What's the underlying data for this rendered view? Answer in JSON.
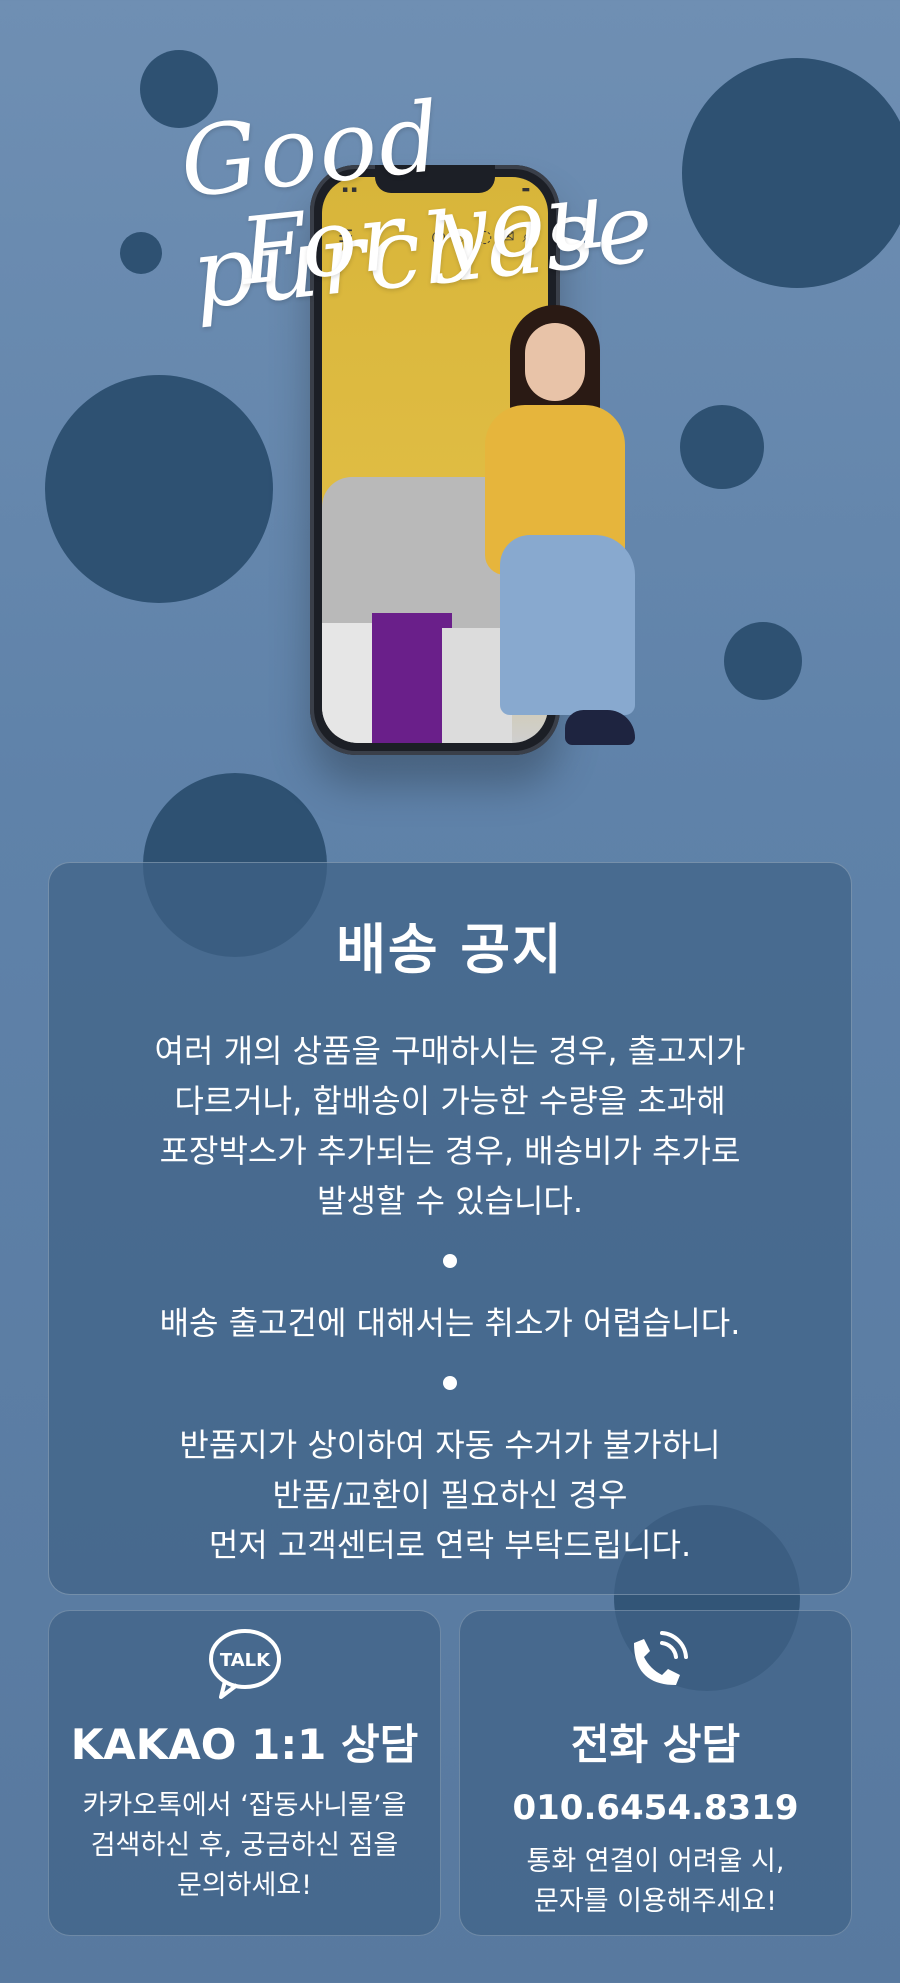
{
  "hero": {
    "script_line1": "Good purchase",
    "script_line2": "For you"
  },
  "notice": {
    "title": "배송 공지",
    "paragraph1_lines": [
      "여러 개의 상품을 구매하시는 경우, 출고지가",
      "다르거나, 합배송이 가능한 수량을 초과해",
      "포장박스가 추가되는 경우, 배송비가 추가로",
      "발생할 수 있습니다."
    ],
    "paragraph2": "배송 출고건에 대해서는 취소가 어렵습니다.",
    "paragraph3_lines": [
      "반품지가 상이하여 자동 수거가 불가하니",
      "반품/교환이 필요하신 경우",
      "먼저 고객센터로 연락 부탁드립니다."
    ]
  },
  "kakao": {
    "icon": "kakao-talk-icon",
    "icon_text": "TALK",
    "title": "KAKAO 1:1 상담",
    "desc_lines": [
      "카카오톡에서 ‘잡동사니몰’을",
      "검색하신 후, 궁금하신 점을",
      "문의하세요!"
    ]
  },
  "call": {
    "icon": "phone-icon",
    "title": "전화 상담",
    "number": "010.6454.8319",
    "desc_lines": [
      "통화 연결이 어려울 시,",
      "문자를 이용해주세요!"
    ]
  },
  "colors": {
    "background": "#6284ab",
    "circle": "#2e5172",
    "panel": "#406286"
  }
}
